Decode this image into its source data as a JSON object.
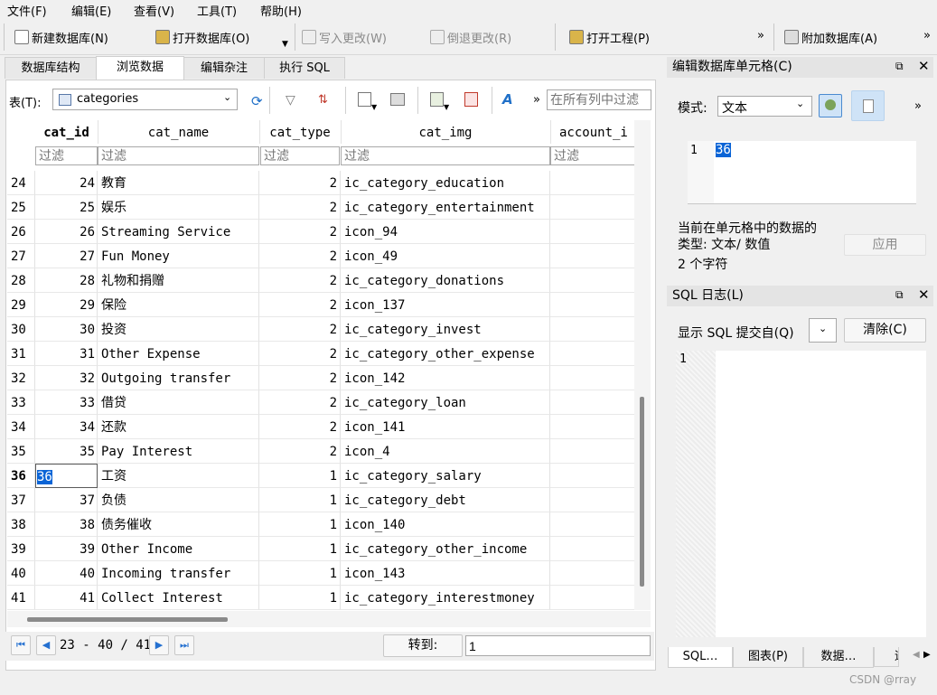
{
  "menu": [
    "文件(F)",
    "编辑(E)",
    "查看(V)",
    "工具(T)",
    "帮助(H)"
  ],
  "toolbar": {
    "new_db": "新建数据库(N)",
    "open_db": "打开数据库(O)",
    "write_changes": "写入更改(W)",
    "revert_changes": "倒退更改(R)",
    "open_project": "打开工程(P)",
    "attach_db": "附加数据库(A)",
    "overflow": "»"
  },
  "tabs": [
    "数据库结构",
    "浏览数据",
    "编辑杂注",
    "执行 SQL"
  ],
  "browse": {
    "table_label": "表(T):",
    "table_value": "categories",
    "filter_all_placeholder": "在所有列中过滤",
    "overflow": "»",
    "columns": [
      "cat_id",
      "cat_name",
      "cat_type",
      "cat_img",
      "account_i"
    ],
    "filter_placeholder": "过滤",
    "rows": [
      {
        "rn": "24",
        "id": "24",
        "name": "教育",
        "type": "2",
        "img": "ic_category_education"
      },
      {
        "rn": "25",
        "id": "25",
        "name": "娱乐",
        "type": "2",
        "img": "ic_category_entertainment"
      },
      {
        "rn": "26",
        "id": "26",
        "name": "Streaming Service",
        "type": "2",
        "img": "icon_94"
      },
      {
        "rn": "27",
        "id": "27",
        "name": "Fun Money",
        "type": "2",
        "img": "icon_49"
      },
      {
        "rn": "28",
        "id": "28",
        "name": "礼物和捐赠",
        "type": "2",
        "img": "ic_category_donations"
      },
      {
        "rn": "29",
        "id": "29",
        "name": "保险",
        "type": "2",
        "img": "icon_137"
      },
      {
        "rn": "30",
        "id": "30",
        "name": "投资",
        "type": "2",
        "img": "ic_category_invest"
      },
      {
        "rn": "31",
        "id": "31",
        "name": "Other Expense",
        "type": "2",
        "img": "ic_category_other_expense"
      },
      {
        "rn": "32",
        "id": "32",
        "name": "Outgoing transfer",
        "type": "2",
        "img": "icon_142"
      },
      {
        "rn": "33",
        "id": "33",
        "name": "借贷",
        "type": "2",
        "img": "ic_category_loan"
      },
      {
        "rn": "34",
        "id": "34",
        "name": "还款",
        "type": "2",
        "img": "icon_141"
      },
      {
        "rn": "35",
        "id": "35",
        "name": "Pay Interest",
        "type": "2",
        "img": "icon_4"
      },
      {
        "rn": "36",
        "id": "36",
        "name": "工资",
        "type": "1",
        "img": "ic_category_salary"
      },
      {
        "rn": "37",
        "id": "37",
        "name": "负债",
        "type": "1",
        "img": "ic_category_debt"
      },
      {
        "rn": "38",
        "id": "38",
        "name": "债务催收",
        "type": "1",
        "img": "icon_140"
      },
      {
        "rn": "39",
        "id": "39",
        "name": "Other Income",
        "type": "1",
        "img": "ic_category_other_income"
      },
      {
        "rn": "40",
        "id": "40",
        "name": "Incoming transfer",
        "type": "1",
        "img": "icon_143"
      },
      {
        "rn": "41",
        "id": "41",
        "name": "Collect Interest",
        "type": "1",
        "img": "ic_category_interestmoney"
      }
    ],
    "pager": "23 - 40 / 41",
    "goto_label": "转到:",
    "goto_value": "1"
  },
  "cell_editor": {
    "title": "编辑数据库单元格(C)",
    "mode_label": "模式:",
    "mode_value": "文本",
    "overflow": "»",
    "line_no": "1",
    "value": "36",
    "type_info_1": "当前在单元格中的数据的",
    "type_info_2": "类型: 文本/ 数值",
    "char_count": "2 个字符",
    "apply": "应用"
  },
  "sql_log": {
    "title": "SQL 日志(L)",
    "show_label": "显示 SQL 提交自(Q)",
    "clear": "清除(C)",
    "line_no": "1"
  },
  "bottom_tabs": [
    "SQL…",
    "图表(P)",
    "数据…",
    "远"
  ],
  "watermark": "CSDN @rray"
}
